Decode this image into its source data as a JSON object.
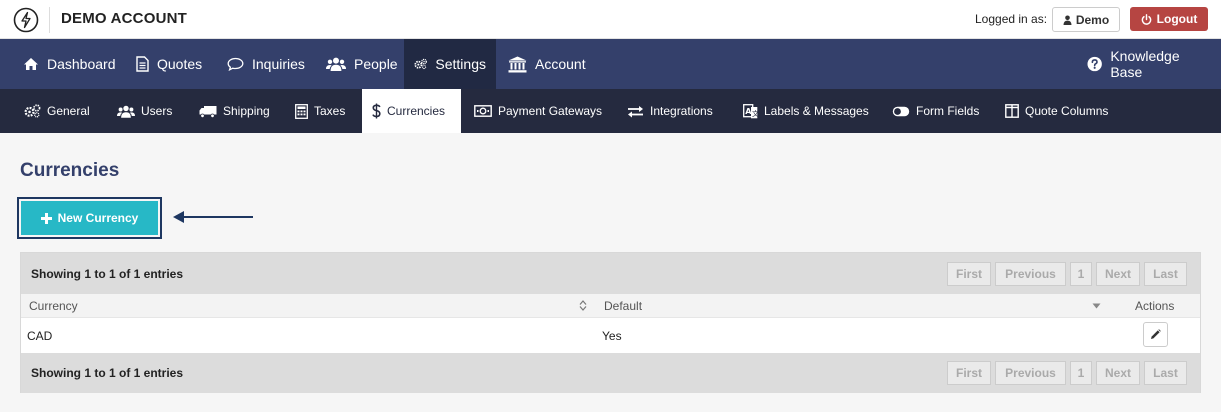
{
  "header": {
    "account_title": "DEMO ACCOUNT",
    "logged_in_label": "Logged in as:",
    "user_label": "Demo",
    "logout_label": "Logout"
  },
  "main_nav": [
    {
      "label": "Dashboard",
      "icon": "home-icon"
    },
    {
      "label": "Quotes",
      "icon": "document-icon"
    },
    {
      "label": "Inquiries",
      "icon": "speech-bubble-icon"
    },
    {
      "label": "People",
      "icon": "users-icon"
    },
    {
      "label": "Settings",
      "icon": "gears-icon",
      "active": true
    },
    {
      "label": "Account",
      "icon": "bank-icon"
    }
  ],
  "knowledge_base": {
    "label": "Knowledge Base",
    "icon": "question-circle-icon"
  },
  "sub_nav": [
    {
      "label": "General",
      "icon": "gears-icon"
    },
    {
      "label": "Users",
      "icon": "users-icon"
    },
    {
      "label": "Shipping",
      "icon": "truck-icon"
    },
    {
      "label": "Taxes",
      "icon": "calculator-icon"
    },
    {
      "label": "Currencies",
      "icon": "dollar-icon",
      "active": true
    },
    {
      "label": "Payment Gateways",
      "icon": "money-icon"
    },
    {
      "label": "Integrations",
      "icon": "exchange-icon"
    },
    {
      "label": "Labels & Messages",
      "icon": "translate-icon"
    },
    {
      "label": "Form Fields",
      "icon": "toggle-icon"
    },
    {
      "label": "Quote Columns",
      "icon": "columns-icon"
    }
  ],
  "page": {
    "title": "Currencies",
    "new_button_label": "New Currency"
  },
  "table": {
    "showing_text": "Showing 1 to 1 of 1 entries",
    "pager": [
      "First",
      "Previous",
      "1",
      "Next",
      "Last"
    ],
    "columns": [
      "Currency",
      "Default",
      "Actions"
    ],
    "rows": [
      {
        "currency": "CAD",
        "default": "Yes"
      }
    ]
  },
  "colors": {
    "main_nav_bg": "#34406b",
    "sub_nav_bg": "#252a3f",
    "accent_button": "#27b8c6",
    "logout_button": "#b64542"
  }
}
